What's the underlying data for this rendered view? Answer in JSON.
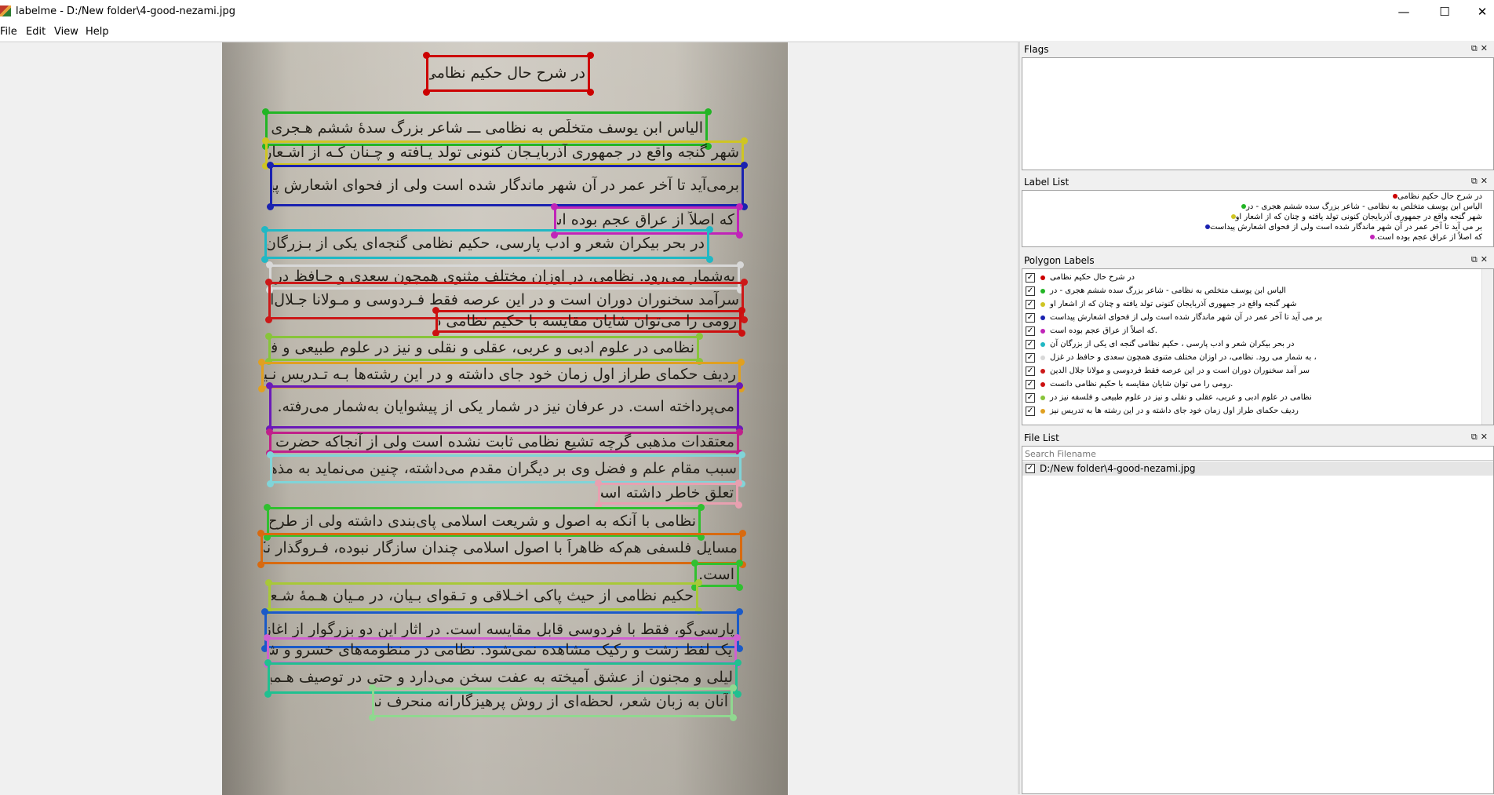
{
  "window": {
    "title": "labelme - D:/New folder\\4-good-nezami.jpg",
    "controls": {
      "minimize": "—",
      "maximize": "☐",
      "close": "✕"
    }
  },
  "menu": [
    "File",
    "Edit",
    "View",
    "Help"
  ],
  "canvas": {
    "shapes": [
      {
        "text": "در شرح حال حکیم نظامی",
        "color": "#cc0000"
      },
      {
        "text": "الیاس ابن یوسف متخلّص به نظامی ـــ شاعر بزرگ سدهٔ ششم هـجری ـــ در",
        "color": "#22b525"
      },
      {
        "text": "شهر گنجه واقع در جمهوری آذربایـجان کنونی تولد یـافته و چـنان کـه از اشـعار او",
        "color": "#cfc523"
      },
      {
        "text": "برمی‌آید تا آخر عمر در آن شهر ماندگار شده است ولی از فحوای اشعارش پیداست",
        "color": "#1a22b0"
      },
      {
        "text": "که اصلاً از عراق عجم بوده است.",
        "color": "#c024b8"
      },
      {
        "text": "در بحر بیکران شعر و ادب پارسی، حکیم نظامی گنجه‌ای یکی از بـزرگان آن",
        "color": "#20b8c4"
      },
      {
        "text": "به‌شمار می‌رود. نظامی، در اوزان مختلف مثنوی همچون سعدی و حـافظ در غـزل،",
        "color": "#d8d8d8"
      },
      {
        "text": "سرآمد سخنوران دوران است و در این عرصه فقط فـردوسی و مـولانا جـلال‌الدیـن",
        "color": "#cc1818"
      },
      {
        "text": "رومی را می‌توان شایان مقایسه با حکیم نظامی دانست.",
        "color": "#cc1010"
      },
      {
        "text": "نظامی در علوم ادبی و عربی، عقلی و نقلی و نیز در علوم طبیعی و فلسفه نیز در",
        "color": "#88c43a"
      },
      {
        "text": "ردیف حکمای طراز اول زمان خود جای داشته و در این رشته‌ها بـه تـدریس نـیز",
        "color": "#e0a020"
      },
      {
        "text": "می‌پرداخته است. در عرفان نیز در شمار یکی از پیشوایان به‌شمار می‌رفته. از لحاظ",
        "color": "#6a1ab8"
      },
      {
        "text": "معتقدات مذهبی گرچه تشیع نظامی ثابت نشده است ولی از آنجاکه حضرت علی را به",
        "color": "#c0208a"
      },
      {
        "text": "سبب مقام علم و فضل وی بر دیگران مقدم می‌داشته، چنین می‌نماید به مذهب شافعی",
        "color": "#80d4d8"
      },
      {
        "text": "تعلق خاطر داشته است.",
        "color": "#e8a0b0"
      },
      {
        "text": "نظامی با آنکه به اصول و شریعت اسلامی پای‌بندی داشته ولی از طرح برخی",
        "color": "#30c030"
      },
      {
        "text": "مسایل فلسفی هم‌که ظاهراً با اصول اسلامی چندان سازگار نبوده، فـروگذار نکـرده",
        "color": "#d86a10"
      },
      {
        "text": "است.",
        "color": "#30c030"
      },
      {
        "text": "حکیم نظامی از حیث پاکی اخـلاقی و تـقوای بـیان، در مـیان هـمهٔ شـعرای",
        "color": "#a8c838"
      },
      {
        "text": "پارسی‌گو، فقط با فردوسی قابل مقایسه است. در اثار این دو بزرگوار از اغاز تا پایان",
        "color": "#1a5ac8"
      },
      {
        "text": "یک لفظ زشت و رکیک مشاهده نمی‌شود. نظامی در منظومه‌های خسرو و شیرین و",
        "color": "#d060d0"
      },
      {
        "text": "لیلی و مجنون از عشق آمیخته به عفت سخن می‌دارد و حتی در توصیف هـمبستری",
        "color": "#20c090"
      },
      {
        "text": "آنان به زبان شعر، لحظه‌ای از روش پرهیزگارانه منحرف نمی‌شود.",
        "color": "#90d890"
      }
    ]
  },
  "docks": {
    "flags": {
      "title": "Flags"
    },
    "label_list": {
      "title": "Label List",
      "items": [
        {
          "text": "در شرح حال حکیم نظامی",
          "color": "#cc0000"
        },
        {
          "text": "الیاس ابن یوسف متخلص به نظامی - شاعر بزرگ سده ششم هجری - در",
          "color": "#22b525"
        },
        {
          "text": "شهر گنجه واقع در جمهوری آذربایجان کنونی تولد یافته و چنان که از اشعار او",
          "color": "#cfc523"
        },
        {
          "text": "بر می آید تا آخر عمر در آن شهر ماندگار شده است ولی از فحوای اشعارش پیداست",
          "color": "#1a22b0"
        },
        {
          "text": "که اصلاً از عراق عجم بوده است.",
          "color": "#c024b8"
        }
      ]
    },
    "polygon_labels": {
      "title": "Polygon Labels",
      "items": [
        {
          "text": "در شرح حال حکیم نظامی",
          "color": "#cc0000"
        },
        {
          "text": "الیاس ابن یوسف متخلص به نظامی - شاعر بزرگ سده ششم هجری - در",
          "color": "#22b525"
        },
        {
          "text": "شهر گنجه واقع در جمهوری آذربایجان کنونی تولد یافته و چنان که از اشعار او",
          "color": "#cfc523"
        },
        {
          "text": "بر می آید تا آخر عمر در آن شهر ماندگار شده است ولی از فحوای اشعارش پیداست",
          "color": "#1a22b0"
        },
        {
          "text": "که اصلاً از عراق عجم بوده است.",
          "color": "#c024b8"
        },
        {
          "text": "در بحر بیکران شعر و ادب پارسی ، حکیم نظامی گنجه ای یکی از بزرگان آن",
          "color": "#20b8c4"
        },
        {
          "text": "به شمار می رود. نظامی، در اوزان مختلف مثنوی همچون سعدی و حافظ در غزل ،",
          "color": "#d8d8d8"
        },
        {
          "text": "سر آمد سخنوران دوران است و در این عرصه فقط فردوسی و مولانا جلال الدین",
          "color": "#cc1818"
        },
        {
          "text": "رومی را می توان شایان مقایسه با حکیم نظامی دانست.",
          "color": "#cc1010"
        },
        {
          "text": "نظامی در علوم ادبی و عربی، عقلی و نقلی و نیز در علوم طبیعی و فلسفه نیز در",
          "color": "#88c43a"
        },
        {
          "text": "ردیف حکمای طراز اول زمان خود جای داشته و در این رشته ها به تدریس نیز",
          "color": "#e0a020"
        }
      ]
    },
    "file_list": {
      "title": "File List",
      "search_placeholder": "Search Filename",
      "files": [
        "D:/New folder\\4-good-nezami.jpg"
      ]
    }
  }
}
